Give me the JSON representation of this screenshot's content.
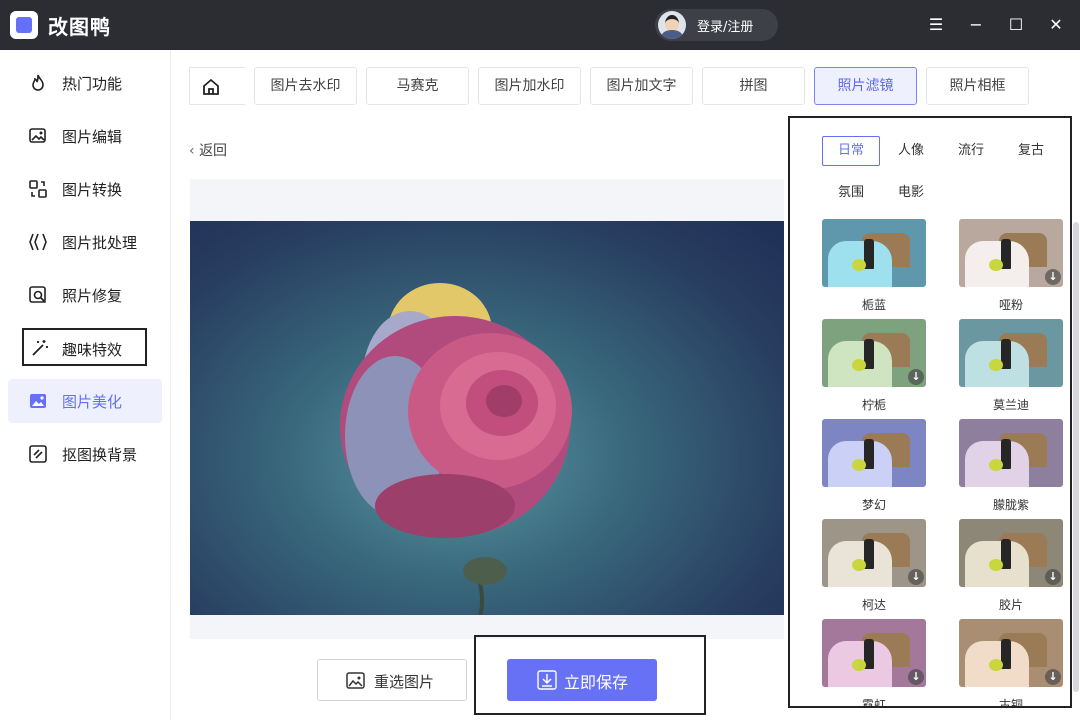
{
  "app": {
    "title": "改图鸭",
    "login": "登录/注册"
  },
  "window_controls": {
    "menu": "☰",
    "minimize": "−",
    "maximize": "☐",
    "close": "✕"
  },
  "sidebar": {
    "items": [
      {
        "label": "热门功能",
        "icon": "flame-icon"
      },
      {
        "label": "图片编辑",
        "icon": "image-edit-icon"
      },
      {
        "label": "图片转换",
        "icon": "convert-icon"
      },
      {
        "label": "图片批处理",
        "icon": "batch-icon"
      },
      {
        "label": "照片修复",
        "icon": "repair-icon"
      },
      {
        "label": "趣味特效",
        "icon": "magic-wand-icon"
      },
      {
        "label": "图片美化",
        "icon": "beautify-icon"
      },
      {
        "label": "抠图换背景",
        "icon": "cutout-icon"
      }
    ]
  },
  "tabs": [
    "图片去水印",
    "马赛克",
    "图片加水印",
    "图片加文字",
    "拼图",
    "照片滤镜",
    "照片相框"
  ],
  "active_tab": "照片滤镜",
  "back_label": "返回",
  "buttons": {
    "reselect": "重选图片",
    "save": "立即保存"
  },
  "filter_categories": [
    "日常",
    "人像",
    "流行",
    "复古",
    "氛围",
    "电影"
  ],
  "active_category": "日常",
  "filters": [
    {
      "name": "栀蓝",
      "download": false
    },
    {
      "name": "哑粉",
      "download": true
    },
    {
      "name": "柠栀",
      "download": true
    },
    {
      "name": "莫兰迪",
      "download": false
    },
    {
      "name": "梦幻",
      "download": false
    },
    {
      "name": "朦胧紫",
      "download": false
    },
    {
      "name": "柯达",
      "download": true
    },
    {
      "name": "胶片",
      "download": true
    },
    {
      "name": "霓虹",
      "download": true
    },
    {
      "name": "古铜",
      "download": true
    }
  ],
  "colors": {
    "accent": "#6470f5",
    "titlebar": "#2b2d33",
    "save_button": "#6771f6"
  }
}
